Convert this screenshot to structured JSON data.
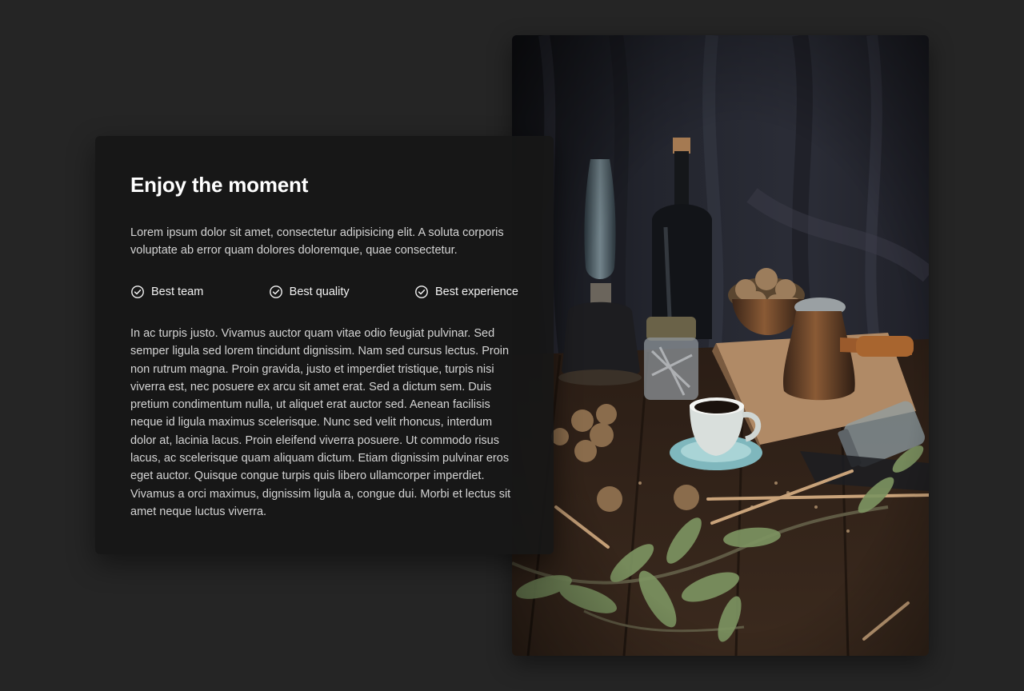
{
  "card": {
    "title": "Enjoy the moment",
    "intro": "Lorem ipsum dolor sit amet, consectetur adipisicing elit. A soluta corporis voluptate ab error quam dolores doloremque, quae consectetur.",
    "features": [
      {
        "icon": "check-circle-icon",
        "label": "Best team"
      },
      {
        "icon": "check-circle-icon",
        "label": "Best quality"
      },
      {
        "icon": "check-circle-icon",
        "label": "Best experience"
      }
    ],
    "body": "In ac turpis justo. Vivamus auctor quam vitae odio feugiat pulvinar. Sed semper ligula sed lorem tincidunt dignissim. Nam sed cursus lectus. Proin non rutrum magna. Proin gravida, justo et imperdiet tristique, turpis nisi viverra est, nec posuere ex arcu sit amet erat. Sed a dictum sem. Duis pretium condimentum nulla, ut aliquet erat auctor sed. Aenean facilisis neque id ligula maximus scelerisque. Nunc sed velit rhoncus, interdum dolor at, lacinia lacus. Proin eleifend viverra posuere. Ut commodo risus lacus, ac scelerisque quam aliquam dictum. Etiam dignissim pulvinar eros eget auctor. Quisque congue turpis quis libero ullamcorper imperdiet. Vivamus a orci maximus, dignissim ligula a, congue dui. Morbi et lectus sit amet neque luctus viverra."
  },
  "photo": {
    "subject": "still life: coffee cup, copper coffee pot, walnuts, oil lamp, bottle, jars and leaves on a wooden table"
  },
  "colors": {
    "background": "#252525",
    "card": "#171717",
    "title": "#ffffff",
    "text": "#d4d4d4"
  }
}
